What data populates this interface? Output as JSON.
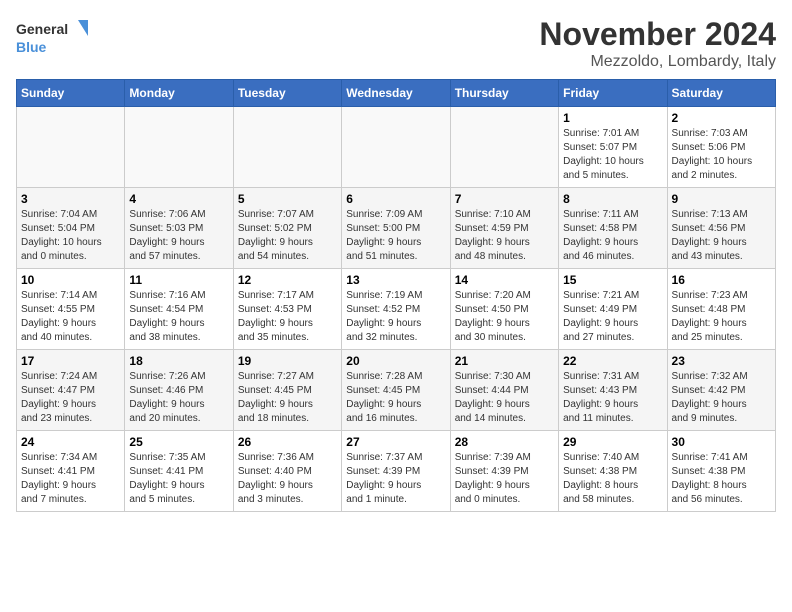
{
  "logo": {
    "line1": "General",
    "line2": "Blue"
  },
  "title": "November 2024",
  "location": "Mezzoldo, Lombardy, Italy",
  "weekdays": [
    "Sunday",
    "Monday",
    "Tuesday",
    "Wednesday",
    "Thursday",
    "Friday",
    "Saturday"
  ],
  "weeks": [
    [
      {
        "day": "",
        "info": ""
      },
      {
        "day": "",
        "info": ""
      },
      {
        "day": "",
        "info": ""
      },
      {
        "day": "",
        "info": ""
      },
      {
        "day": "",
        "info": ""
      },
      {
        "day": "1",
        "info": "Sunrise: 7:01 AM\nSunset: 5:07 PM\nDaylight: 10 hours\nand 5 minutes."
      },
      {
        "day": "2",
        "info": "Sunrise: 7:03 AM\nSunset: 5:06 PM\nDaylight: 10 hours\nand 2 minutes."
      }
    ],
    [
      {
        "day": "3",
        "info": "Sunrise: 7:04 AM\nSunset: 5:04 PM\nDaylight: 10 hours\nand 0 minutes."
      },
      {
        "day": "4",
        "info": "Sunrise: 7:06 AM\nSunset: 5:03 PM\nDaylight: 9 hours\nand 57 minutes."
      },
      {
        "day": "5",
        "info": "Sunrise: 7:07 AM\nSunset: 5:02 PM\nDaylight: 9 hours\nand 54 minutes."
      },
      {
        "day": "6",
        "info": "Sunrise: 7:09 AM\nSunset: 5:00 PM\nDaylight: 9 hours\nand 51 minutes."
      },
      {
        "day": "7",
        "info": "Sunrise: 7:10 AM\nSunset: 4:59 PM\nDaylight: 9 hours\nand 48 minutes."
      },
      {
        "day": "8",
        "info": "Sunrise: 7:11 AM\nSunset: 4:58 PM\nDaylight: 9 hours\nand 46 minutes."
      },
      {
        "day": "9",
        "info": "Sunrise: 7:13 AM\nSunset: 4:56 PM\nDaylight: 9 hours\nand 43 minutes."
      }
    ],
    [
      {
        "day": "10",
        "info": "Sunrise: 7:14 AM\nSunset: 4:55 PM\nDaylight: 9 hours\nand 40 minutes."
      },
      {
        "day": "11",
        "info": "Sunrise: 7:16 AM\nSunset: 4:54 PM\nDaylight: 9 hours\nand 38 minutes."
      },
      {
        "day": "12",
        "info": "Sunrise: 7:17 AM\nSunset: 4:53 PM\nDaylight: 9 hours\nand 35 minutes."
      },
      {
        "day": "13",
        "info": "Sunrise: 7:19 AM\nSunset: 4:52 PM\nDaylight: 9 hours\nand 32 minutes."
      },
      {
        "day": "14",
        "info": "Sunrise: 7:20 AM\nSunset: 4:50 PM\nDaylight: 9 hours\nand 30 minutes."
      },
      {
        "day": "15",
        "info": "Sunrise: 7:21 AM\nSunset: 4:49 PM\nDaylight: 9 hours\nand 27 minutes."
      },
      {
        "day": "16",
        "info": "Sunrise: 7:23 AM\nSunset: 4:48 PM\nDaylight: 9 hours\nand 25 minutes."
      }
    ],
    [
      {
        "day": "17",
        "info": "Sunrise: 7:24 AM\nSunset: 4:47 PM\nDaylight: 9 hours\nand 23 minutes."
      },
      {
        "day": "18",
        "info": "Sunrise: 7:26 AM\nSunset: 4:46 PM\nDaylight: 9 hours\nand 20 minutes."
      },
      {
        "day": "19",
        "info": "Sunrise: 7:27 AM\nSunset: 4:45 PM\nDaylight: 9 hours\nand 18 minutes."
      },
      {
        "day": "20",
        "info": "Sunrise: 7:28 AM\nSunset: 4:45 PM\nDaylight: 9 hours\nand 16 minutes."
      },
      {
        "day": "21",
        "info": "Sunrise: 7:30 AM\nSunset: 4:44 PM\nDaylight: 9 hours\nand 14 minutes."
      },
      {
        "day": "22",
        "info": "Sunrise: 7:31 AM\nSunset: 4:43 PM\nDaylight: 9 hours\nand 11 minutes."
      },
      {
        "day": "23",
        "info": "Sunrise: 7:32 AM\nSunset: 4:42 PM\nDaylight: 9 hours\nand 9 minutes."
      }
    ],
    [
      {
        "day": "24",
        "info": "Sunrise: 7:34 AM\nSunset: 4:41 PM\nDaylight: 9 hours\nand 7 minutes."
      },
      {
        "day": "25",
        "info": "Sunrise: 7:35 AM\nSunset: 4:41 PM\nDaylight: 9 hours\nand 5 minutes."
      },
      {
        "day": "26",
        "info": "Sunrise: 7:36 AM\nSunset: 4:40 PM\nDaylight: 9 hours\nand 3 minutes."
      },
      {
        "day": "27",
        "info": "Sunrise: 7:37 AM\nSunset: 4:39 PM\nDaylight: 9 hours\nand 1 minute."
      },
      {
        "day": "28",
        "info": "Sunrise: 7:39 AM\nSunset: 4:39 PM\nDaylight: 9 hours\nand 0 minutes."
      },
      {
        "day": "29",
        "info": "Sunrise: 7:40 AM\nSunset: 4:38 PM\nDaylight: 8 hours\nand 58 minutes."
      },
      {
        "day": "30",
        "info": "Sunrise: 7:41 AM\nSunset: 4:38 PM\nDaylight: 8 hours\nand 56 minutes."
      }
    ]
  ]
}
